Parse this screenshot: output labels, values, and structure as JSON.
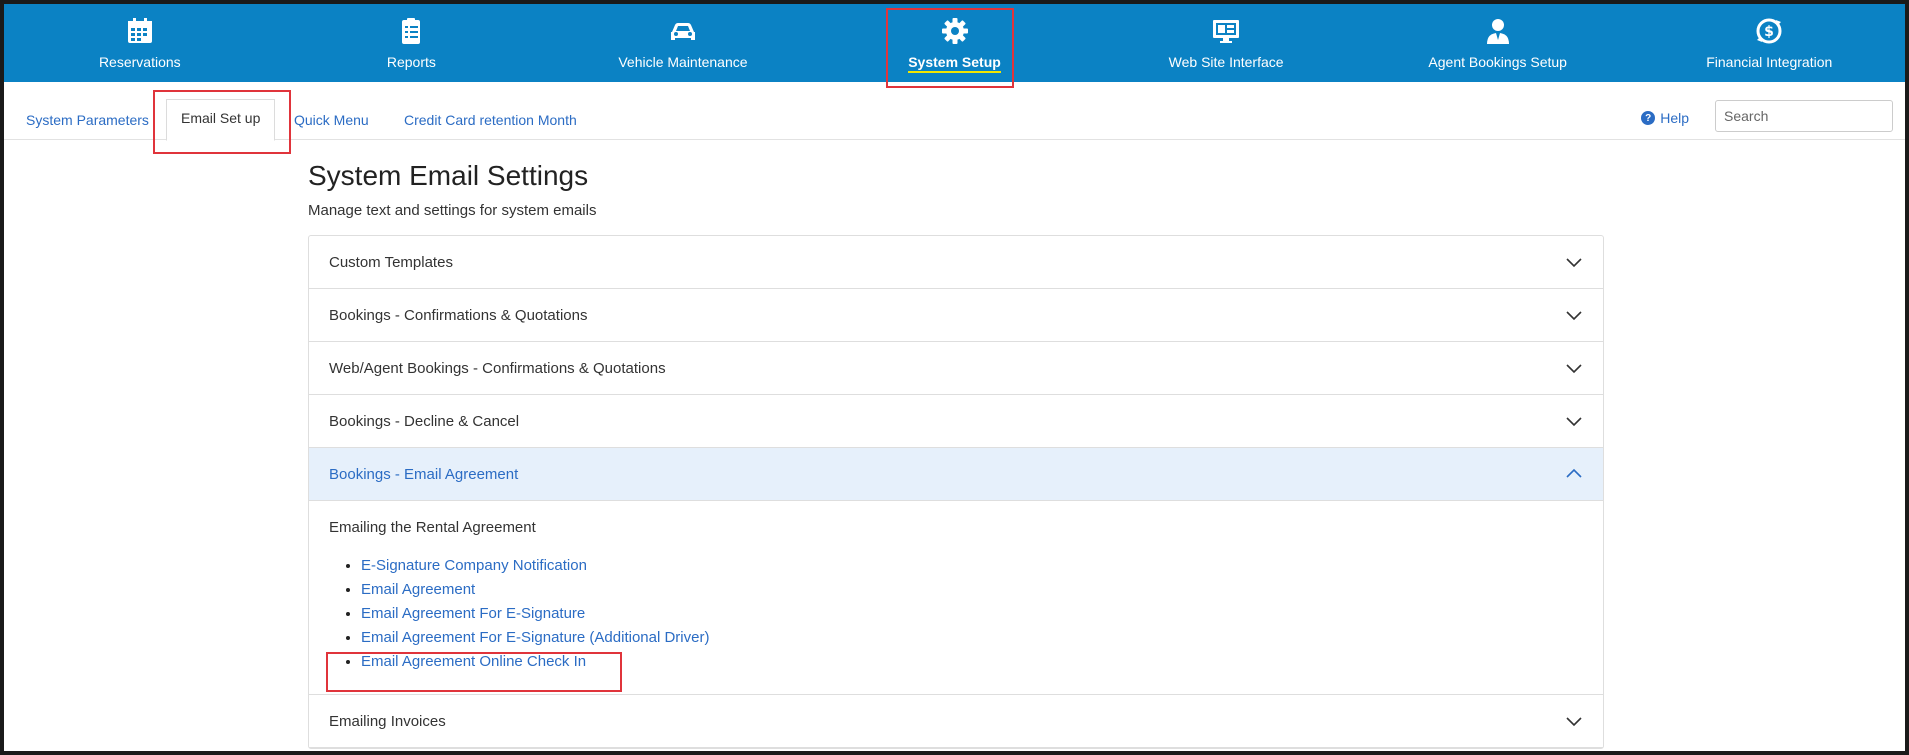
{
  "topnav": {
    "items": [
      {
        "label": "Reservations",
        "icon": "calendar-icon"
      },
      {
        "label": "Reports",
        "icon": "clipboard-icon"
      },
      {
        "label": "Vehicle Maintenance",
        "icon": "car-icon"
      },
      {
        "label": "System Setup",
        "icon": "gear-icon",
        "active": true
      },
      {
        "label": "Web Site Interface",
        "icon": "monitor-icon"
      },
      {
        "label": "Agent Bookings Setup",
        "icon": "agent-icon"
      },
      {
        "label": "Financial Integration",
        "icon": "dollar-cycle-icon"
      }
    ]
  },
  "subnav": {
    "tabs": [
      "System Parameters",
      "Email Set up",
      "Quick Menu",
      "Credit Card retention Month"
    ],
    "active_tab": "Email Set up",
    "help_label": "Help",
    "search_placeholder": "Search"
  },
  "main": {
    "title": "System Email Settings",
    "subtitle": "Manage text and settings for system emails",
    "sections": [
      {
        "label": "Custom Templates",
        "open": false
      },
      {
        "label": "Bookings - Confirmations & Quotations",
        "open": false
      },
      {
        "label": "Web/Agent Bookings - Confirmations & Quotations",
        "open": false
      },
      {
        "label": "Bookings - Decline & Cancel",
        "open": false
      },
      {
        "label": "Bookings - Email Agreement",
        "open": true
      },
      {
        "label": "Emailing Invoices",
        "open": false
      }
    ],
    "open_section": {
      "heading": "Emailing the Rental Agreement",
      "links": [
        "E-Signature Company Notification",
        "Email Agreement",
        "Email Agreement For E-Signature",
        "Email Agreement For E-Signature (Additional Driver)",
        "Email Agreement Online Check In"
      ]
    }
  },
  "colors": {
    "nav_bg": "#0b82c4",
    "link": "#2b6cc4",
    "highlight": "#e0343b",
    "active_underline": "#f2e600"
  }
}
